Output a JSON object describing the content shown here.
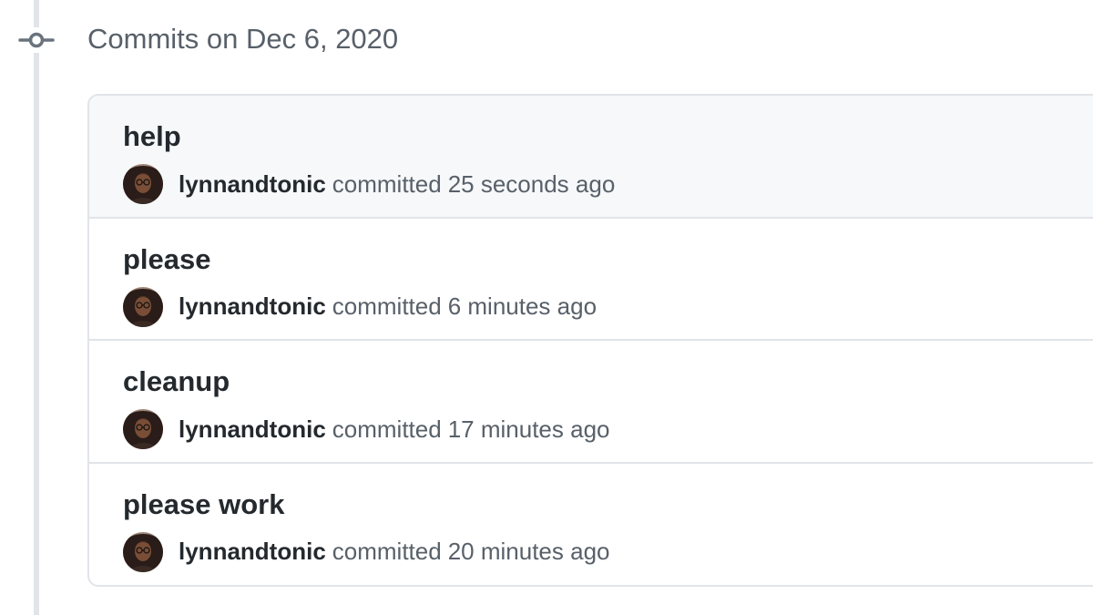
{
  "group": {
    "title": "Commits on Dec 6, 2020"
  },
  "commits": [
    {
      "message": "help",
      "author": "lynnandtonic",
      "action": "committed",
      "time": "25 seconds ago"
    },
    {
      "message": "please",
      "author": "lynnandtonic",
      "action": "committed",
      "time": "6 minutes ago"
    },
    {
      "message": "cleanup",
      "author": "lynnandtonic",
      "action": "committed",
      "time": "17 minutes ago"
    },
    {
      "message": "please work",
      "author": "lynnandtonic",
      "action": "committed",
      "time": "20 minutes ago"
    }
  ],
  "icons": {
    "timeline": "git-commit-icon",
    "avatar": "user-avatar"
  },
  "colors": {
    "text_primary": "#24292e",
    "text_secondary": "#586069",
    "border": "#e1e4e8",
    "highlight_row": "#f6f8fa"
  }
}
